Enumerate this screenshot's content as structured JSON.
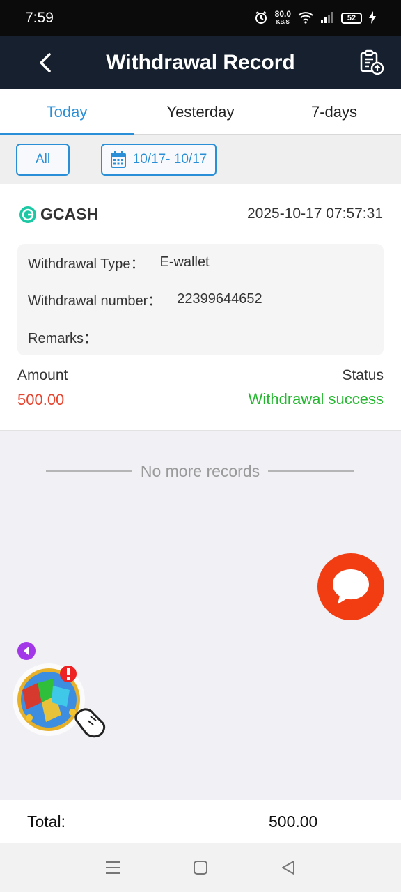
{
  "status_bar": {
    "time": "7:59",
    "speed_value": "80.0",
    "speed_unit": "KB/S",
    "battery": "52"
  },
  "header": {
    "title": "Withdrawal Record"
  },
  "tabs": [
    {
      "label": "Today",
      "active": true
    },
    {
      "label": "Yesterday",
      "active": false
    },
    {
      "label": "7-days",
      "active": false
    }
  ],
  "filters": {
    "all_label": "All",
    "date_range": "10/17- 10/17"
  },
  "record": {
    "provider": "GCASH",
    "datetime": "2025-10-17 07:57:31",
    "type_label": "Withdrawal Type：",
    "type_value": "E-wallet",
    "number_label": "Withdrawal number：",
    "number_value": "22399644652",
    "remarks_label": "Remarks：",
    "remarks_value": "",
    "amount_label": "Amount",
    "amount_value": "500.00",
    "status_label": "Status",
    "status_value": "Withdrawal success"
  },
  "list_end_text": "No more records",
  "footer": {
    "total_label": "Total:",
    "total_value": "500.00"
  },
  "colors": {
    "header_bg": "#16202f",
    "accent_blue": "#2a8fd6",
    "amount_red": "#e6452f",
    "success_green": "#23b82e",
    "chat_orange": "#f23d12"
  },
  "icons": [
    "back-arrow-icon",
    "record-upload-icon",
    "calendar-icon",
    "gcash-logo-icon",
    "chat-bubble-icon",
    "collapse-arrow-icon",
    "game-cube-icon",
    "menu-icon",
    "home-icon",
    "back-triangle-icon"
  ]
}
